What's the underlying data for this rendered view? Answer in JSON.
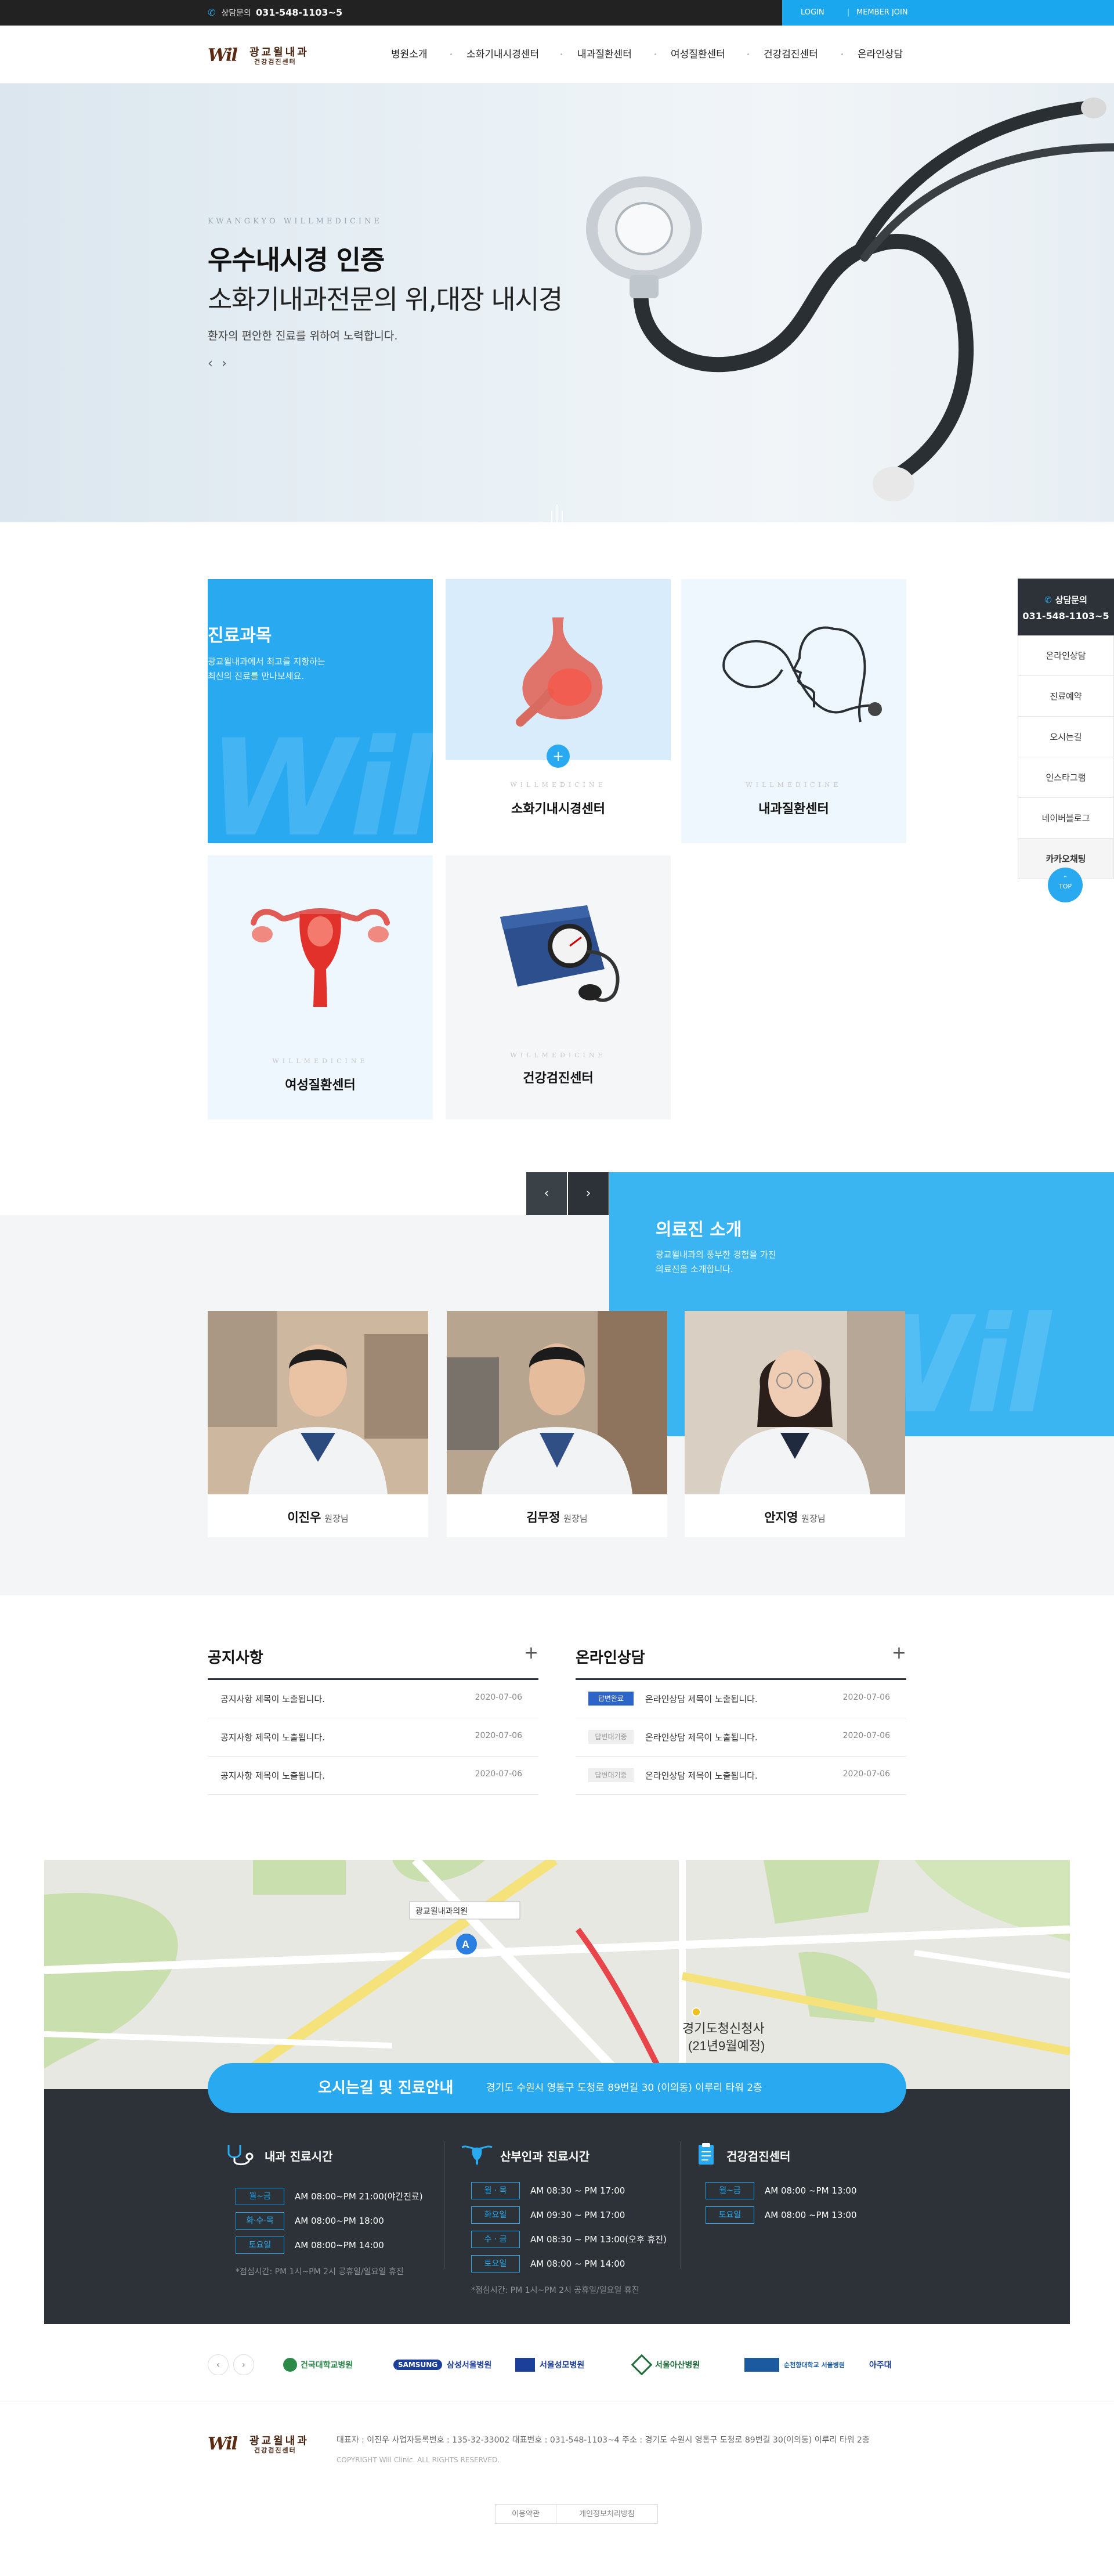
{
  "topbar": {
    "call_label": "상담문의",
    "call_number": "031-548-1103~5",
    "login": "LOGIN",
    "separator": "|",
    "join": "MEMBER JOIN"
  },
  "brand": {
    "mark": "Wil",
    "name": "광교윌내과",
    "sub": "건강검진센터"
  },
  "nav": [
    "병원소개",
    "소화기내시경센터",
    "내과질환센터",
    "여성질환센터",
    "건강검진센터",
    "온라인상담"
  ],
  "hero": {
    "sub_en": "KWANGKYO WILLMEDICINE",
    "title1": "우수내시경 인증",
    "title2": "소화기내과전문의 위,대장 내시경",
    "desc": "환자의 편안한 진료를 위하여 노력합니다.",
    "prev": "‹",
    "next": "›"
  },
  "departments": {
    "title": "진료과목",
    "desc1": "광교윌내과에서 최고를 지향하는",
    "desc2": "최선의 진료를 만나보세요.",
    "watermark": "Wil",
    "en_label": "WILLMEDICINE",
    "cards": [
      "소화기내시경센터",
      "내과질환센터",
      "여성질환센터",
      "건강검진센터"
    ],
    "plus": "+"
  },
  "quick_menu": {
    "head_label": "상담문의",
    "head_number": "031-548-1103~5",
    "items": [
      "온라인상담",
      "진료예약",
      "오시는길",
      "인스타그램",
      "네이버블로그",
      "카카오채팅"
    ],
    "top_label": "TOP"
  },
  "doctors": {
    "title": "의료진 소개",
    "desc1": "광교윌내과의 풍부한 경험을 가진",
    "desc2": "의료진을 소개합니다.",
    "prev": "‹",
    "next": "›",
    "list": [
      {
        "name": "이진우",
        "role": "원장님"
      },
      {
        "name": "김무정",
        "role": "원장님"
      },
      {
        "name": "안지영",
        "role": "원장님"
      }
    ]
  },
  "notice": {
    "title": "공지사항",
    "plus": "+",
    "rows": [
      {
        "text": "공지사항 제목이 노출됩니다.",
        "date": "2020-07-06"
      },
      {
        "text": "공지사항 제목이 노출됩니다.",
        "date": "2020-07-06"
      },
      {
        "text": "공지사항 제목이 노출됩니다.",
        "date": "2020-07-06"
      }
    ]
  },
  "consult": {
    "title": "온라인상담",
    "plus": "+",
    "rows": [
      {
        "status": "답변완료",
        "text": "온라인상담 제목이 노출됩니다.",
        "date": "2020-07-06"
      },
      {
        "status": "답변대기중",
        "text": "온라인상담 제목이 노출됩니다.",
        "date": "2020-07-06"
      },
      {
        "status": "답변대기중",
        "text": "온라인상담 제목이 노출됩니다.",
        "date": "2020-07-06"
      }
    ]
  },
  "map": {
    "title": "오시는길 및 진료안내",
    "address": "경기도 수원시 영통구 도청로 89번길 30 (이의동) 이루리 타워 2층",
    "marker": "A",
    "popup": "광교윌내과의원",
    "landmark1": "경기도청신청사",
    "landmark2": "(21년9월예정)"
  },
  "hours": {
    "internal": {
      "title": "내과 진료시간",
      "rows": [
        {
          "day": "월~금",
          "time": "AM 08:00~PM 21:00(야간진료)"
        },
        {
          "day": "화·수·목",
          "time": "AM 08:00~PM 18:00"
        },
        {
          "day": "토요일",
          "time": "AM 08:00~PM 14:00"
        }
      ],
      "note": "*점심시간: PM 1시~PM 2시 공휴일/일요일 휴진"
    },
    "women": {
      "title": "산부인과 진료시간",
      "rows": [
        {
          "day": "월 · 목",
          "time": "AM 08:30 ~ PM 17:00"
        },
        {
          "day": "화요일",
          "time": "AM 09:30 ~ PM 17:00"
        },
        {
          "day": "수 · 금",
          "time": "AM 08:30 ~ PM 13:00(오후 휴진)"
        },
        {
          "day": "토요일",
          "time": "AM 08:00 ~ PM 14:00"
        }
      ],
      "note": "*점심시간: PM 1시~PM 2시 공휴일/일요일 휴진"
    },
    "checkup": {
      "title": "건강검진센터",
      "rows": [
        {
          "day": "월~금",
          "time": "AM 08:00 ~PM 13:00"
        },
        {
          "day": "토요일",
          "time": "AM 08:00 ~PM 13:00"
        }
      ]
    }
  },
  "partners": {
    "prev": "‹",
    "next": "›",
    "logos": [
      "건국대학교병원",
      "SAMSUNG",
      "삼성서울병원",
      "서울성모병원",
      "서울아산병원",
      "순천향대학교 서울병원",
      "아주대"
    ]
  },
  "footer": {
    "info": "대표자 : 이진우     사업자등록번호 : 135-32-33002     대표번호 : 031-548-1103~4     주소 : 경기도 수원시 영통구 도청로 89번길 30(이의동) 이루리 타워 2층",
    "copyright": "COPYRIGHT Will Clinic. ALL RIGHTS RESERVED.",
    "terms": "이용약관",
    "privacy": "개인정보처리방침"
  },
  "colors": {
    "accent": "#29aaf0",
    "dark": "#2c3237",
    "brand": "#5a2a12"
  }
}
